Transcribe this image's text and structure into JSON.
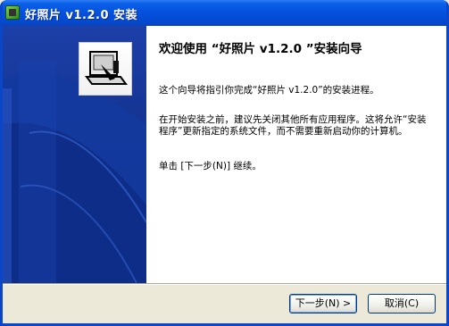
{
  "window": {
    "title": "好照片 v1.2.0 安装"
  },
  "wizard": {
    "heading": "欢迎使用 “好照片 v1.2.0 ”安装向导",
    "paragraphs": [
      "这个向导将指引你完成“好照片 v1.2.0”的安装进程。",
      "在开始安装之前，建议先关闭其他所有应用程序。这将允许“安装程序”更新指定的系统文件，而不需要重新启动你的计算机。",
      "单击 [下一步(N)] 继续。"
    ]
  },
  "buttons": {
    "next": "下一步(N) >",
    "cancel": "取消(C)"
  },
  "colors": {
    "title_bar": "#0550DC",
    "side_panel": "#0F2D8F",
    "dialog_bg": "#ECE9D8"
  }
}
